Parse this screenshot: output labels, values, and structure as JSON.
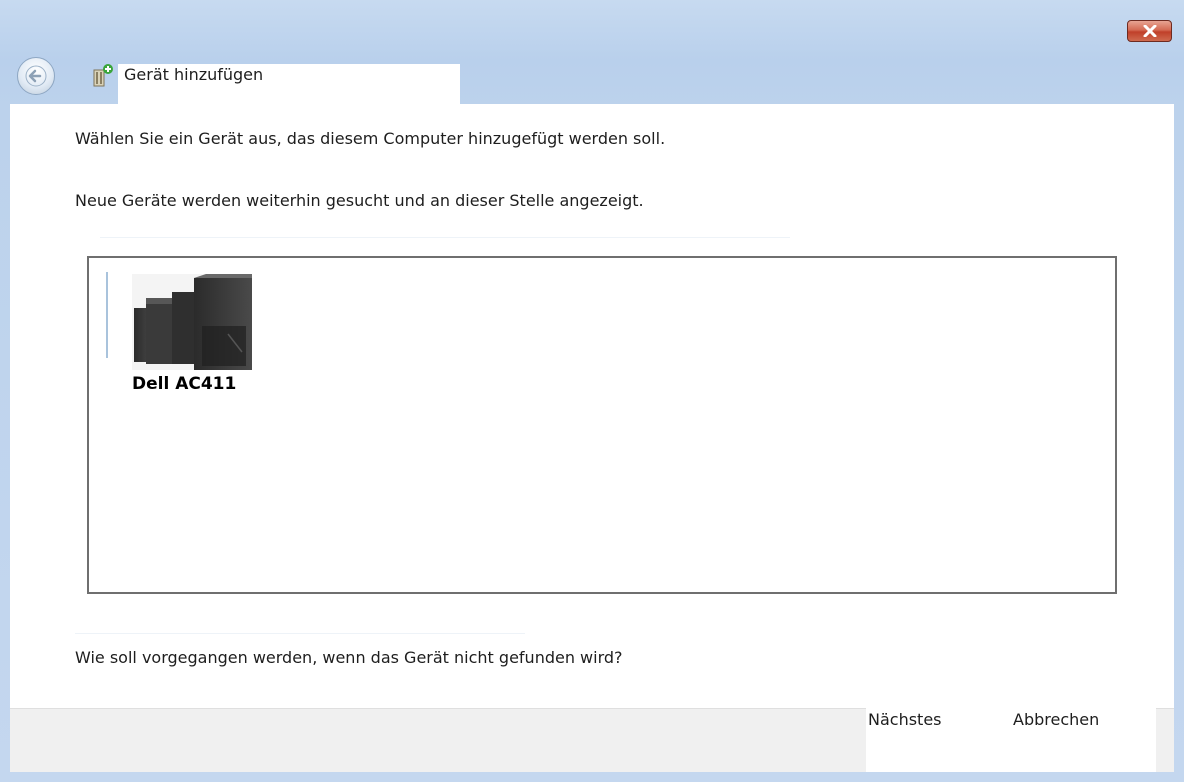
{
  "window": {
    "title": "Gerät hinzufügen",
    "close_icon": "close-x-icon",
    "back_icon": "back-arrow-icon",
    "wizard_icon": "add-device-icon"
  },
  "main": {
    "instruction": "Wählen Sie ein Gerät aus, das diesem Computer hinzugefügt werden soll.",
    "searching_note": "Neue Geräte werden weiterhin gesucht und an dieser Stelle angezeigt.",
    "devices": [
      {
        "name": "Dell AC411",
        "icon": "speaker-device-icon"
      }
    ],
    "help_link": "Wie soll vorgegangen werden, wenn das Gerät nicht gefunden wird?"
  },
  "footer": {
    "next_label": "Nächstes",
    "cancel_label": "Abbrechen"
  },
  "colors": {
    "frame": "#bcd2ec",
    "close_button": "#c9523b",
    "list_border": "#6f6f6f",
    "footer_bg": "#f0f0f0"
  }
}
